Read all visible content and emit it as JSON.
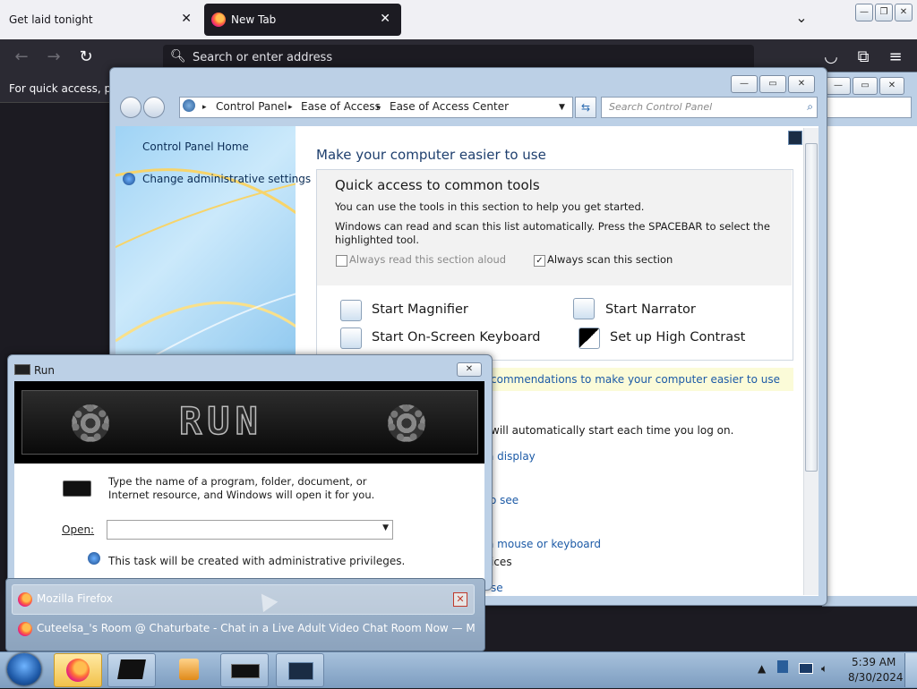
{
  "firefox": {
    "tabs": [
      {
        "title": "Get laid tonight",
        "close": "✕"
      },
      {
        "title": "New Tab",
        "close": "✕"
      }
    ],
    "tab_list_icon": "chevron-down-icon",
    "address_placeholder": "Search or enter address",
    "bookmarks_hint": "For quick access, place",
    "window_controls": [
      "—",
      "❐",
      "✕"
    ]
  },
  "control_panel": {
    "breadcrumbs": [
      "Control Panel",
      "Ease of Access",
      "Ease of Access Center"
    ],
    "search_placeholder": "Search Control Panel",
    "sidebar": {
      "home": "Control Panel Home",
      "admin": "Change administrative settings"
    },
    "heading": "Make your computer easier to use",
    "quick_access": {
      "title": "Quick access to common tools",
      "line1": "You can use the tools in this section to help you get started.",
      "line2": "Windows can read and scan this list automatically.  Press the SPACEBAR to select the highlighted tool.",
      "read_aloud": "Always read this section aloud",
      "read_aloud_checked": false,
      "scan": "Always scan this section",
      "scan_checked": true
    },
    "tools": {
      "magnifier": "Start Magnifier",
      "narrator": "Start Narrator",
      "keyboard": "Start On-Screen Keyboard",
      "contrast": "Set up High Contrast"
    },
    "recommend_link": "commendations to make your computer easier to use",
    "auto_start": "will automatically start each time you log on.",
    "links": [
      "a display",
      "o see",
      "a mouse or keyboard"
    ],
    "fragments": [
      "ices",
      "se"
    ]
  },
  "run": {
    "title": "Run",
    "banner": "RUN",
    "description": "Type the name of a program, folder, document, or Internet resource, and Windows will open it for you.",
    "open_label": "Open:",
    "open_value": "",
    "admin_note": "This task will be created with administrative privileges."
  },
  "preview": {
    "app": "Mozilla Firefox",
    "window": "Cuteelsa_'s Room @ Chaturbate - Chat in a Live Adult Video Chat Room Now — Mozilla Fir..."
  },
  "taskbar": {
    "time": "5:39 AM",
    "date": "8/30/2024"
  }
}
